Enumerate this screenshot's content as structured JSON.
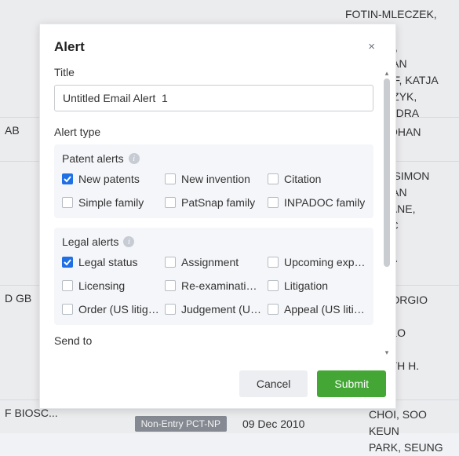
{
  "modal": {
    "heading": "Alert",
    "close_glyph": "×",
    "title_label": "Title",
    "title_value": "Untitled Email Alert  1",
    "alert_type_label": "Alert type",
    "patent_panel": {
      "header": "Patent alerts",
      "info_glyph": "i",
      "items": [
        {
          "label": "New patents",
          "checked": true
        },
        {
          "label": "New invention",
          "checked": false
        },
        {
          "label": "Citation",
          "checked": false
        },
        {
          "label": "Simple family",
          "checked": false
        },
        {
          "label": "PatSnap family",
          "checked": false
        },
        {
          "label": "INPADOC family",
          "checked": false
        }
      ]
    },
    "legal_panel": {
      "header": "Legal alerts",
      "info_glyph": "i",
      "items": [
        {
          "label": "Legal status",
          "checked": true
        },
        {
          "label": "Assignment",
          "checked": false
        },
        {
          "label": "Upcoming expir...",
          "checked": false
        },
        {
          "label": "Licensing",
          "checked": false
        },
        {
          "label": "Re-examination/...",
          "checked": false
        },
        {
          "label": "Litigation",
          "checked": false
        },
        {
          "label": "Order (US litigati...",
          "checked": false
        },
        {
          "label": "Judgement (US l...",
          "checked": false
        },
        {
          "label": "Appeal (US litig...",
          "checked": false
        }
      ]
    },
    "send_to_label": "Send to",
    "cancel": "Cancel",
    "submit": "Submit"
  },
  "background": {
    "rows": [
      {
        "left": "",
        "right": "FOTIN-MLECZEK,\nMARIOLA\nTHALLER,\nSEBASTIAN\nBAUMHOF, KATJA\nKOWALCZYK,\nALEKSANDRA"
      },
      {
        "left": "AB",
        "right": "NORN, JOHAN"
      },
      {
        "left": "",
        "right": "BROWN, SIMON\nSEBASTIAN\nMCFARLANE,\nJAN, ERIC\nMEYER,\nISABELLA"
      },
      {
        "left": "D GB",
        "right": "SISSI, GIORGIO\nCELLI,\nMARCELLO\nBSTEIN,\nELIZABETH H."
      },
      {
        "left": "F BIOSC...",
        "pill": "Non-Entry PCT-NP",
        "date": "09 Dec 2010",
        "right": "CHOI, SOO KEUN\nPARK, SEUNG"
      }
    ]
  }
}
